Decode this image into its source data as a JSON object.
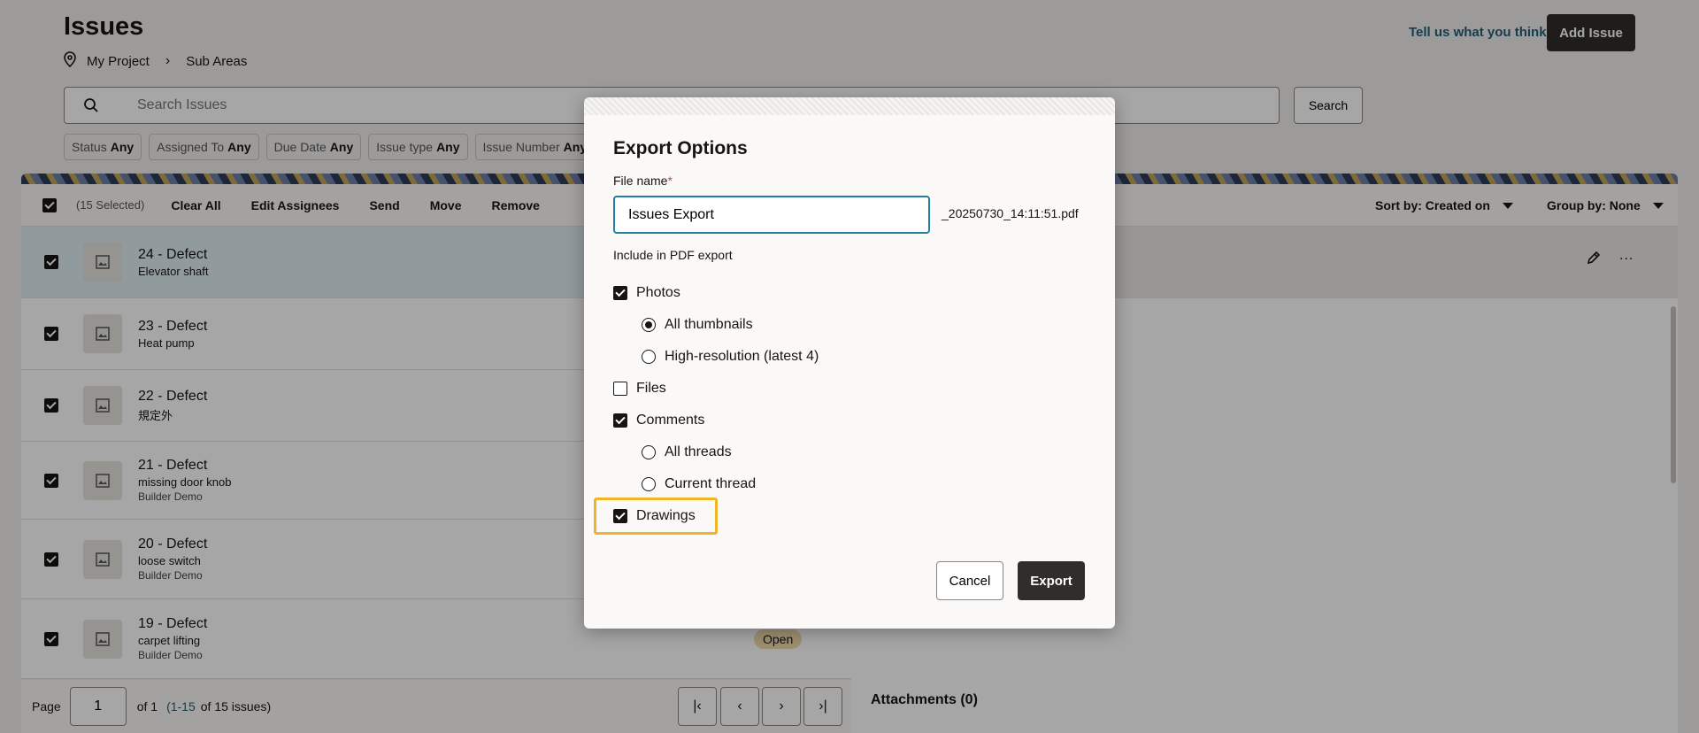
{
  "header": {
    "title": "Issues",
    "breadcrumb": [
      "My Project",
      "Sub Areas"
    ],
    "feedback_link": "Tell us what you think",
    "add_issue_label": "Add Issue"
  },
  "search": {
    "placeholder": "Search Issues",
    "button_label": "Search"
  },
  "filters": [
    {
      "label": "Status",
      "value": "Any"
    },
    {
      "label": "Assigned To",
      "value": "Any"
    },
    {
      "label": "Due Date",
      "value": "Any"
    },
    {
      "label": "Issue type",
      "value": "Any"
    },
    {
      "label": "Issue Number",
      "value": "Any"
    }
  ],
  "toolbar": {
    "selected_count": "(15 Selected)",
    "actions": [
      "Clear All",
      "Edit Assignees",
      "Send",
      "Move",
      "Remove"
    ],
    "sort_label": "Sort by: Created on",
    "group_label": "Group by: None"
  },
  "issues": [
    {
      "title": "24 - Defect",
      "subtitle": "Elevator shaft",
      "meta": "",
      "status": ""
    },
    {
      "title": "23 - Defect",
      "subtitle": "Heat pump",
      "meta": "",
      "status": ""
    },
    {
      "title": "22 - Defect",
      "subtitle": "規定外",
      "meta": "",
      "status": ""
    },
    {
      "title": "21 - Defect",
      "subtitle": "missing door knob",
      "meta": "Builder Demo",
      "status": ""
    },
    {
      "title": "20 - Defect",
      "subtitle": "loose switch",
      "meta": "Builder Demo",
      "status": ""
    },
    {
      "title": "19 - Defect",
      "subtitle": "carpet lifting",
      "meta": "Builder Demo",
      "status": "Open"
    }
  ],
  "pager": {
    "page_label": "Page",
    "page_value": "1",
    "of_label": "of 1",
    "range": "(1-15",
    "total": "of 15 issues)"
  },
  "details": {
    "attachments_label": "Attachments (0)",
    "more_label": "..."
  },
  "dialog": {
    "title": "Export Options",
    "file_name_label": "File name",
    "required_mark": "*",
    "file_name_value": "Issues Export",
    "file_name_suffix": "_20250730_14:11:51.pdf",
    "include_label": "Include in PDF export",
    "options": {
      "photos": "Photos",
      "all_thumbnails": "All thumbnails",
      "high_res": "High-resolution (latest 4)",
      "files": "Files",
      "comments": "Comments",
      "all_threads": "All threads",
      "current_thread": "Current thread",
      "drawings": "Drawings"
    },
    "cancel_label": "Cancel",
    "export_label": "Export"
  },
  "colors": {
    "accent_focus": "#227e9e",
    "primary_button": "#312d2a",
    "highlight": "#f0b429",
    "link": "#1f5f7a"
  }
}
